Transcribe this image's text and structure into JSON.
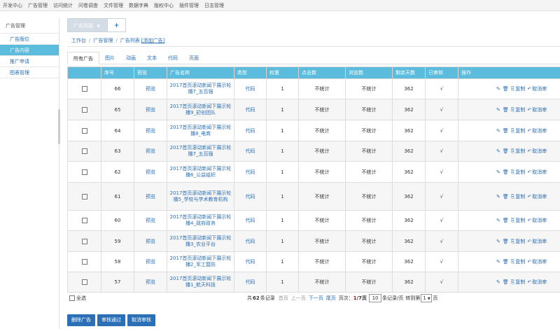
{
  "topnav": [
    "开发中心",
    "广告管理",
    "访问统计",
    "问卷调查",
    "文件管理",
    "数据字典",
    "版权中心",
    "插件管理",
    "日志管理"
  ],
  "sidebar": {
    "group": "广告管理",
    "items": [
      {
        "label": "广告版位",
        "active": false
      },
      {
        "label": "广告内容",
        "active": true
      },
      {
        "label": "推广申请",
        "active": false
      },
      {
        "label": "图表管理",
        "active": false
      }
    ]
  },
  "tabs": {
    "current": "广告页面",
    "close": "✖",
    "add": "+"
  },
  "breadcrumb": {
    "home": "工作台",
    "module": "广告管理",
    "page": "广告列表",
    "action": "[添加广告]"
  },
  "subtabs": [
    "所有广告",
    "图片",
    "动画",
    "文本",
    "代码",
    "页面"
  ],
  "table": {
    "headers": [
      "",
      "序号",
      "预览",
      "广告名称",
      "类型",
      "权重",
      "点击数",
      "浏览数",
      "剩余天数",
      "已审核",
      "操作"
    ],
    "rows": [
      {
        "id": "66",
        "preview": "预览",
        "name": "2017首页滚动新闻下展示轮播7_五百强",
        "type": "代码",
        "weight": "1",
        "clicks": "不统计",
        "views": "不统计",
        "days": "362",
        "approved": "√"
      },
      {
        "id": "65",
        "preview": "预览",
        "name": "2017首页滚动新闻下展示轮播9_初创团队",
        "type": "代码",
        "weight": "1",
        "clicks": "不统计",
        "views": "不统计",
        "days": "362",
        "approved": "√"
      },
      {
        "id": "64",
        "preview": "预览",
        "name": "2017首页滚动新闻下展示轮播8_电商",
        "type": "代码",
        "weight": "1",
        "clicks": "不统计",
        "views": "不统计",
        "days": "362",
        "approved": "√"
      },
      {
        "id": "63",
        "preview": "预览",
        "name": "2017首页滚动新闻下展示轮播7_五百强",
        "type": "代码",
        "weight": "1",
        "clicks": "不统计",
        "views": "不统计",
        "days": "362",
        "approved": "√"
      },
      {
        "id": "62",
        "preview": "预览",
        "name": "2017首页滚动新闻下展示轮播6_公益组织",
        "type": "代码",
        "weight": "1",
        "clicks": "不统计",
        "views": "不统计",
        "days": "362",
        "approved": "√"
      },
      {
        "id": "61",
        "preview": "预览",
        "name": "2017首页滚动新闻下展示轮播5_学校与学术教育机构",
        "type": "代码",
        "weight": "1",
        "clicks": "不统计",
        "views": "不统计",
        "days": "362",
        "approved": "√"
      },
      {
        "id": "60",
        "preview": "预览",
        "name": "2017首页滚动新闻下展示轮播4_政府政务",
        "type": "代码",
        "weight": "1",
        "clicks": "不统计",
        "views": "不统计",
        "days": "362",
        "approved": "√"
      },
      {
        "id": "59",
        "preview": "预览",
        "name": "2017首页滚动新闻下展示轮播3_农业平台",
        "type": "代码",
        "weight": "1",
        "clicks": "不统计",
        "views": "不统计",
        "days": "362",
        "approved": "√"
      },
      {
        "id": "58",
        "preview": "预览",
        "name": "2017首页滚动新闻下展示轮播2_军工暨防",
        "type": "代码",
        "weight": "1",
        "clicks": "不统计",
        "views": "不统计",
        "days": "362",
        "approved": "√"
      },
      {
        "id": "57",
        "preview": "预览",
        "name": "2017首页滚动新闻下展示轮播1_航天科技",
        "type": "代码",
        "weight": "1",
        "clicks": "不统计",
        "views": "不统计",
        "days": "362",
        "approved": "√"
      }
    ],
    "ops": {
      "copy": "复制",
      "cancel": "取消审"
    }
  },
  "footer": {
    "select_all": "全选",
    "total_prefix": "共",
    "total": "62",
    "total_suffix": "条记录",
    "first": "首页",
    "prev": "上一页",
    "next": "下一页",
    "last": "尾页",
    "page_label": "页次：",
    "page_current": "1",
    "page_total": "/7页",
    "per_page": "10",
    "per_page_suffix": "条记录/页",
    "goto_label": "转到第",
    "goto_value": "1",
    "goto_suffix": "页"
  },
  "buttons": [
    "删除广告",
    "审核通过",
    "取消审核"
  ],
  "colors": {
    "header_bg": "#5bbcdd",
    "button_bg": "#2b6fb6",
    "link": "#2c6fb5"
  }
}
